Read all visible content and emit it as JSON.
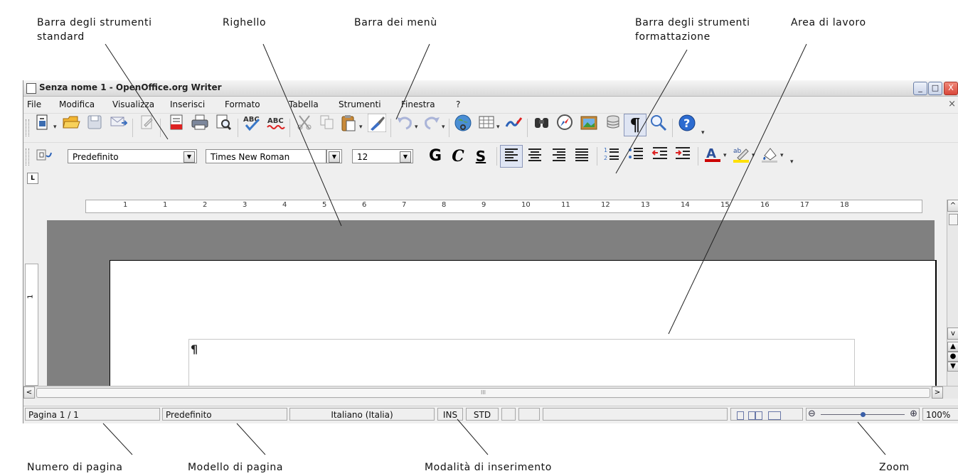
{
  "annotations": {
    "standard_toolbar": "Barra degli strumenti\nstandard",
    "ruler": "Righello",
    "menu_bar": "Barra dei menù",
    "formatting_toolbar": "Barra degli strumenti\nformattazione",
    "work_area": "Area di lavoro",
    "page_number": "Numero di pagina",
    "page_style": "Modello di pagina",
    "insert_mode": "Modalità di inserimento",
    "zoom": "Zoom"
  },
  "window": {
    "title": "Senza nome 1 - OpenOffice.org Writer",
    "controls": {
      "minimize": "_",
      "maximize": "□",
      "close": "X"
    }
  },
  "menu": {
    "items": [
      "File",
      "Modifica",
      "Visualizza",
      "Inserisci",
      "Formato",
      "Tabella",
      "Strumenti",
      "Finestra",
      "?"
    ],
    "close": "×"
  },
  "standard_toolbar": {
    "icons": [
      "new-icon",
      "open-icon",
      "save-icon",
      "email-icon",
      "edit-file-icon",
      "export-pdf-icon",
      "print-icon",
      "page-preview-icon",
      "spellcheck-icon",
      "autospellcheck-icon",
      "cut-icon",
      "copy-icon",
      "paste-icon",
      "format-paintbrush-icon",
      "undo-icon",
      "redo-icon",
      "hyperlink-icon",
      "table-icon",
      "draw-functions-icon",
      "find-replace-icon",
      "navigator-icon",
      "gallery-icon",
      "data-sources-icon",
      "formatting-marks-icon",
      "zoom-icon",
      "help-icon"
    ]
  },
  "formatting_toolbar": {
    "style": "Predefinito",
    "font": "Times New Roman",
    "size": "12",
    "bold": "G",
    "italic": "C",
    "underline": "S",
    "icons": [
      "styles-icon",
      "align-left-icon",
      "align-center-icon",
      "align-right-icon",
      "justify-icon",
      "numbering-icon",
      "bullets-icon",
      "decrease-indent-icon",
      "increase-indent-icon",
      "font-color-icon",
      "highlighting-icon",
      "background-color-icon"
    ]
  },
  "ruler": {
    "tab_stop": "L",
    "labels": [
      "1",
      "1",
      "2",
      "3",
      "4",
      "5",
      "6",
      "7",
      "8",
      "9",
      "10",
      "11",
      "12",
      "13",
      "14",
      "15",
      "16",
      "17",
      "18"
    ],
    "vertical_label": "1"
  },
  "document": {
    "paragraph_mark": "¶"
  },
  "scrollbars": {
    "left_arrow": "<",
    "right_arrow": ">",
    "up_arrow": "^",
    "down_arrow": "v",
    "grip": "III"
  },
  "status": {
    "page": "Pagina 1 / 1",
    "style": "Predefinito",
    "language": "Italiano (Italia)",
    "insert": "INS",
    "selection": "STD",
    "zoom_out": "⊖",
    "zoom_in": "⊕",
    "zoom": "100%",
    "zoom_level": 1.0
  }
}
